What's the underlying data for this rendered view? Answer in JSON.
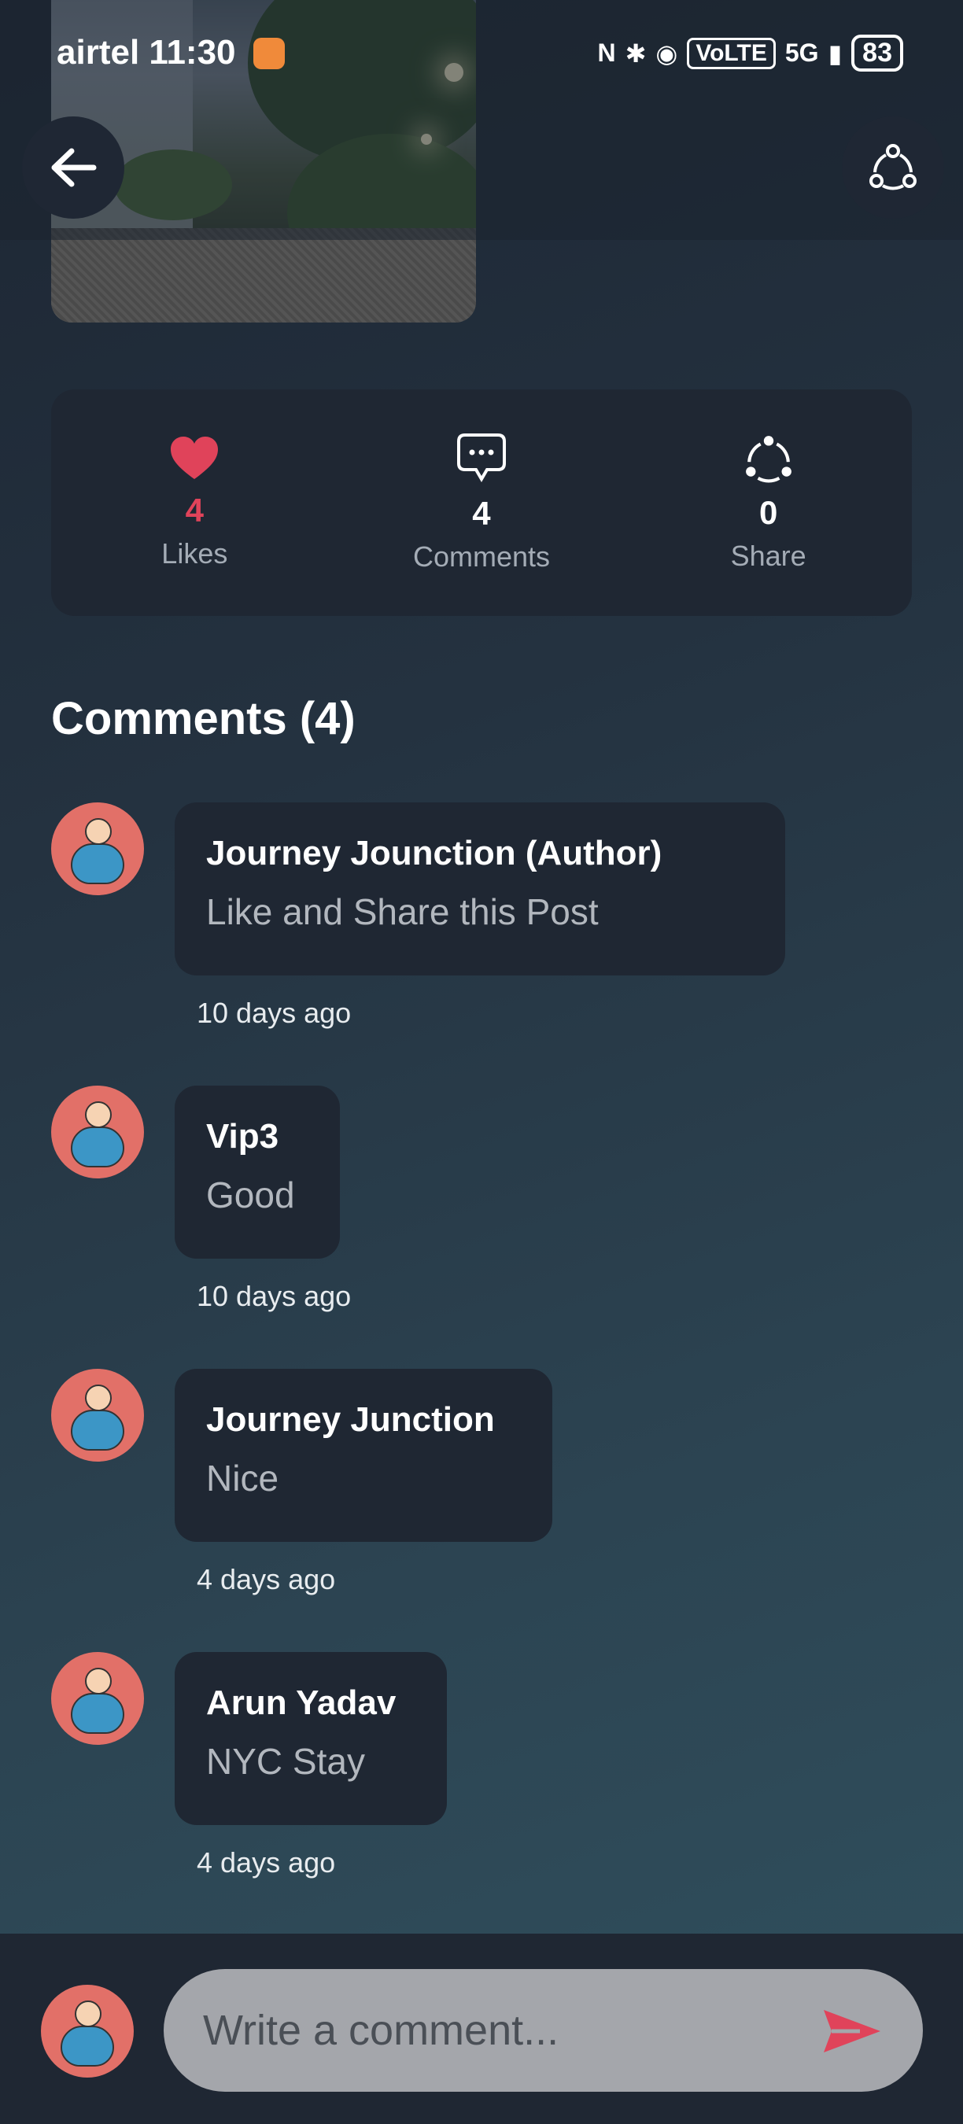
{
  "status_bar": {
    "carrier": "airtel",
    "time": "11:30",
    "network": "5G",
    "volte": "VoLTE",
    "battery": "83"
  },
  "stats": {
    "likes": {
      "count": "4",
      "label": "Likes",
      "color": "#e0435a"
    },
    "comments": {
      "count": "4",
      "label": "Comments"
    },
    "share": {
      "count": "0",
      "label": "Share"
    }
  },
  "comments_section": {
    "title": "Comments (4)",
    "items": [
      {
        "name": "Journey  Jounction (Author)",
        "text": "Like and Share this Post",
        "time": "10 days ago"
      },
      {
        "name": "Vip3",
        "text": "Good",
        "time": "10 days ago"
      },
      {
        "name": "Journey Junction",
        "text": "Nice",
        "time": "4 days ago"
      },
      {
        "name": "Arun Yadav",
        "text": "NYC Stay",
        "time": "4 days ago"
      }
    ]
  },
  "composer": {
    "placeholder": "Write a comment...",
    "send_color": "#e0435a"
  },
  "icons": [
    "back-arrow-icon",
    "share-icon",
    "heart-icon",
    "comment-icon",
    "share-icon",
    "avatar-icon",
    "send-icon"
  ]
}
